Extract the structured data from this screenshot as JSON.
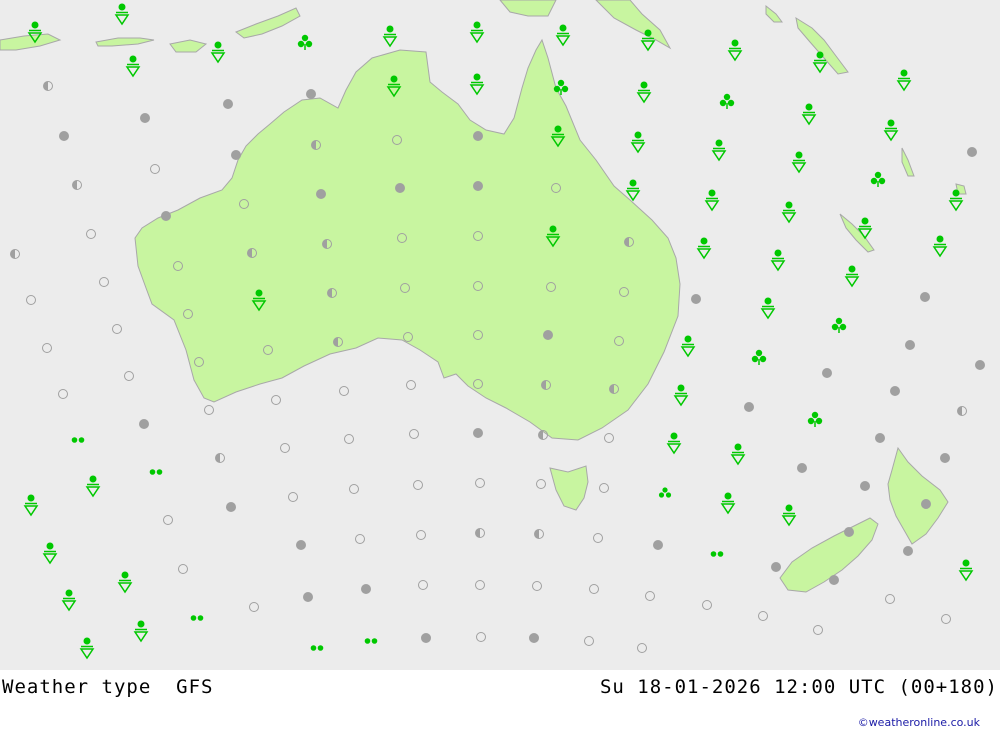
{
  "footer": {
    "title": "Weather type  GFS",
    "datetime": "Su 18-01-2026 12:00 UTC (00+180)",
    "credit": "©weatheronline.co.uk"
  },
  "colors": {
    "sea": "#ececec",
    "land": "#c8f5a0",
    "coast": "#a8a8a8",
    "symbol_green": "#00c800",
    "symbol_grey": "#a0a0a0"
  },
  "symbol_legend": {
    "clear": "open-circle-icon",
    "partly_cloudy": "half-circle-icon",
    "overcast": "filled-grey-circle-icon",
    "showers": "shower-triangle-icon",
    "thunder_showers": "clover-icon",
    "drizzle": "double-dot-icon",
    "rain": "triple-dot-icon"
  }
}
